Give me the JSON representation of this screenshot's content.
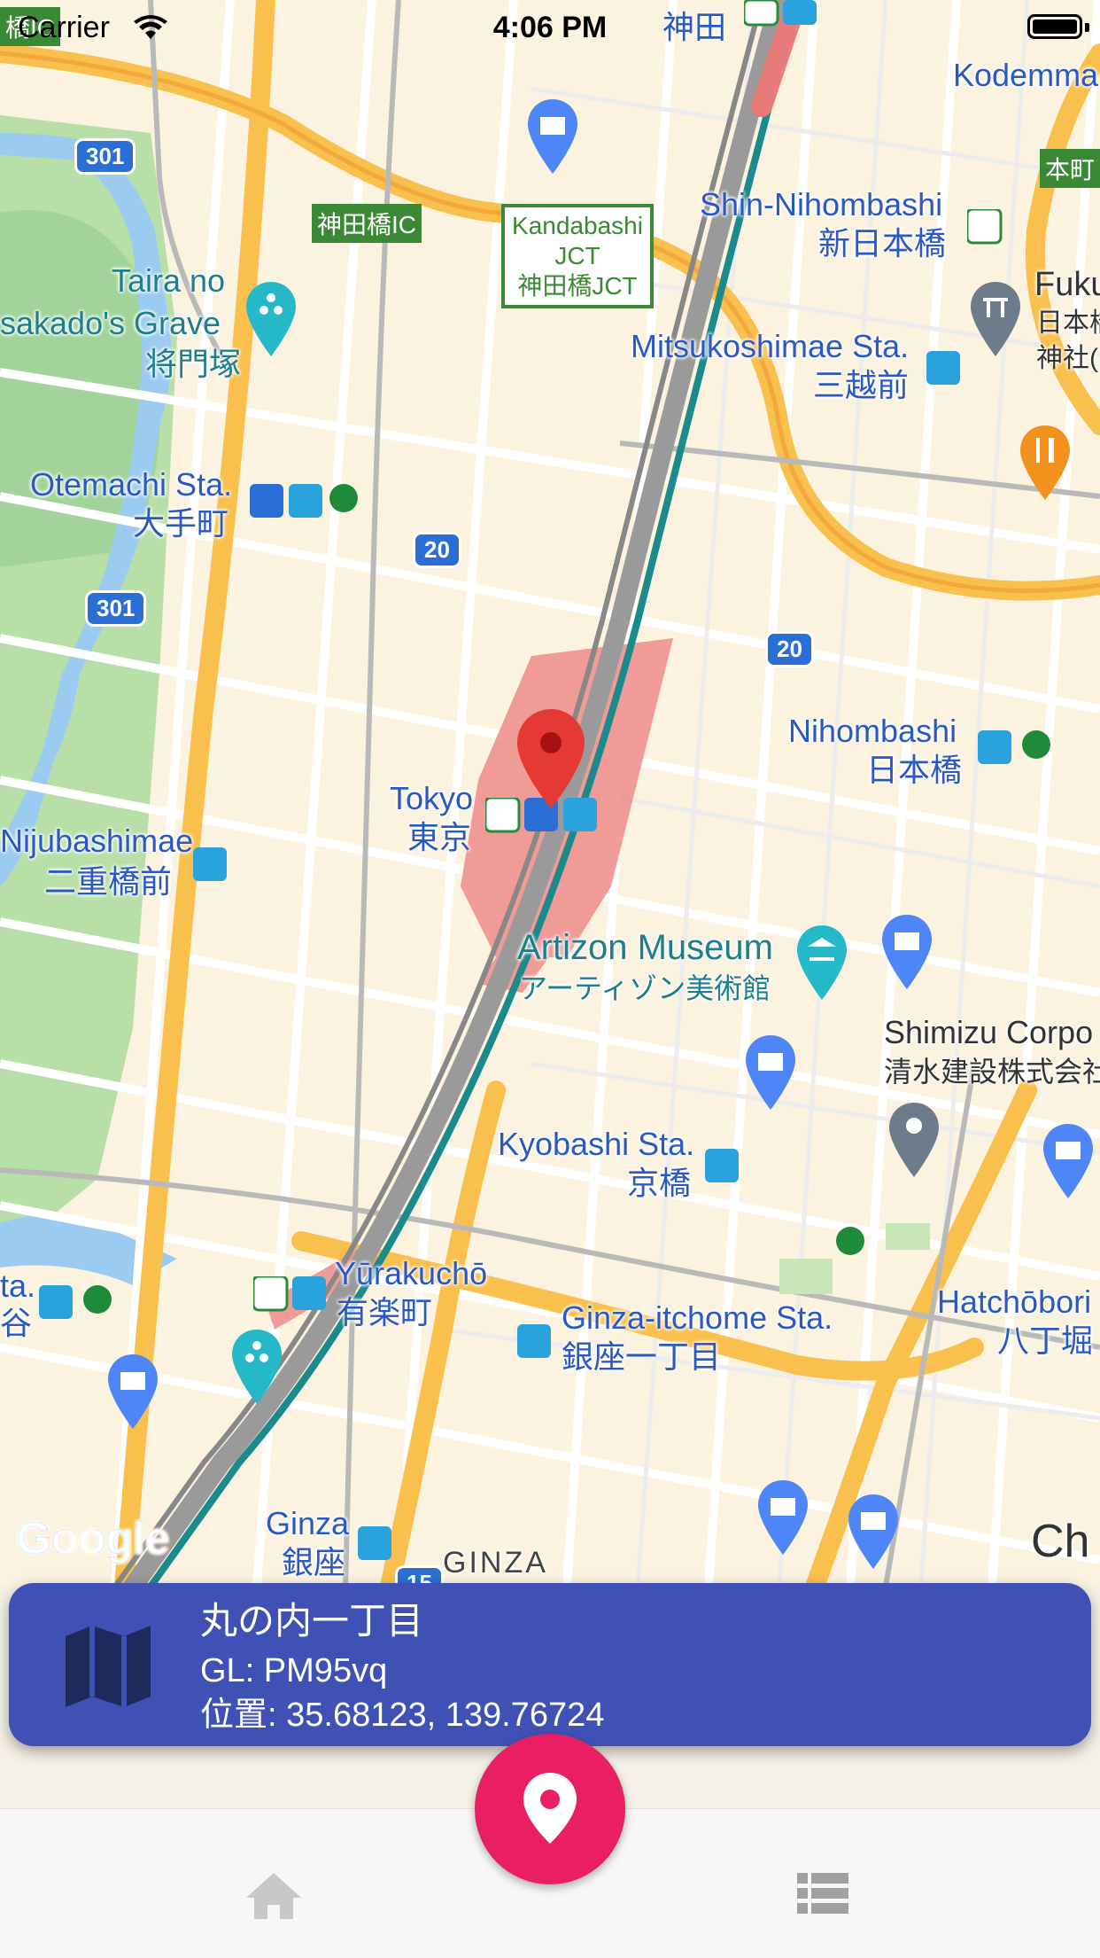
{
  "status_bar": {
    "carrier": "Carrier",
    "time": "4:06 PM"
  },
  "map": {
    "labels": {
      "kanda": "神田",
      "kodemma": "Kodemma",
      "honcho": "本町",
      "shin_nihombashi_en": "Shin-Nihombashi",
      "shin_nihombashi_jp": "新日本橋",
      "fuku_en": "Fuku",
      "fuku_jp1": "日本橋",
      "fuku_jp2": "神社(",
      "taira_en1": "Taira no",
      "taira_en2": "sakado's Grave",
      "taira_jp": "将門塚",
      "mitsukoshimae_en": "Mitsukoshimae Sta.",
      "mitsukoshimae_jp": "三越前",
      "otemachi_en": "Otemachi Sta.",
      "otemachi_jp": "大手町",
      "nihombashi_en": "Nihombashi",
      "nihombashi_jp": "日本橋",
      "tokyo_en": "Tokyo",
      "tokyo_jp": "東京",
      "nijubashimae_en": "Nijubashimae",
      "nijubashimae_jp": "二重橋前",
      "artizon_en": "Artizon Museum",
      "artizon_jp": "アーティゾン美術館",
      "shimizu_en": "Shimizu Corpo",
      "shimizu_jp": "清水建設株式会社",
      "kyobashi_en": "Kyobashi Sta.",
      "kyobashi_jp": "京橋",
      "yurakucho_en": "Yūrakuchō",
      "yurakucho_jp": "有楽町",
      "ginza_itchome_en": "Ginza-itchome Sta.",
      "ginza_itchome_jp": "銀座一丁目",
      "hatchobori_en": "Hatchōbori",
      "hatchobori_jp": "八丁堀",
      "ginza_en": "Ginza",
      "ginza_jp": "銀座",
      "ginza_caps": "GINZA",
      "ta": "ta.",
      "tani": "谷",
      "chu": "Ch",
      "kandabashi_ic": "神田橋IC",
      "ic_topleft": "橋IC",
      "jct_1": "Kandabashi",
      "jct_2": "JCT",
      "jct_3": "神田橋JCT",
      "route_301a": "301",
      "route_301b": "301",
      "route_20a": "20",
      "route_20b": "20",
      "route_15": "15"
    },
    "attribution": "Google"
  },
  "info_card": {
    "title": "丸の内一丁目",
    "gl": "GL:  PM95vq",
    "position": "位置: 35.68123, 139.76724",
    "icon": "map-icon"
  },
  "fab": {
    "icon": "location-pin-icon"
  },
  "tab_bar": {
    "home_icon": "home-icon",
    "list_icon": "list-icon"
  },
  "colors": {
    "card": "#3f51b5",
    "fab": "#e91e63",
    "map_pin": "#e53935",
    "water": "#9ccbf1",
    "park": "#a8d8a0",
    "highway": "#f9c04e"
  }
}
